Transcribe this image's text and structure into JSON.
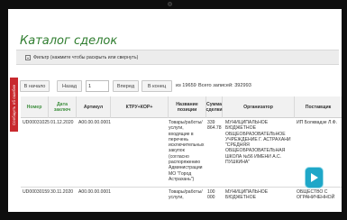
{
  "page": {
    "title": "Каталог сделок",
    "filter_label": "Фильтр (нажмите чтобы раскрыть или свернуть)",
    "side_tab_label": "Сообщить об ошибке"
  },
  "pager": {
    "first_label": "В начало",
    "prev_label": "Назад",
    "current_page": "1",
    "next_label": "Вперед",
    "last_label": "В конец",
    "of_text": "из 19659",
    "total_text": "Всего записей: 392993"
  },
  "table": {
    "headers": {
      "number": "Номер",
      "date": "Дата заключ",
      "article": "Артикул",
      "ktru": "КТРУ+КОР+",
      "name": "Название позиции",
      "sum": "Сумма сделки",
      "organizer": "Организатор",
      "supplier": "Поставщик"
    },
    "rows": [
      {
        "number": "UD00031025",
        "date": "01.12.2020",
        "article": "A00.00.00.0001",
        "ktru": "",
        "name": "Товары/работы/ услуги, входящие в перечень исключительных закупок (согласно распоряжению Администрации МО \"Город Астрахань\")",
        "sum": "339 864.78",
        "organizer": "МУНИЦИПАЛЬНОЕ БЮДЖЕТНОЕ ОБЩЕОБРАЗОВАТЕЛЬНОЕ УЧРЕЖДЕНИЕ Г. АСТРАХАНИ \"СРЕДНЯЯ ОБЩЕОБРАЗОВАТЕЛЬНАЯ ШКОЛА №56 ИМЕНИ А.С. ПУШКИНА\"",
        "supplier": "ИП Болквадзе Л.Ф."
      },
      {
        "number": "UD00030159",
        "date": "30.11.2020",
        "article": "A00.00.00.0001",
        "ktru": "",
        "name": "Товары/работы/ услуги,",
        "sum": "100 000",
        "organizer": "МУНИЦИПАЛЬНОЕ БЮДЖЕТНОЕ",
        "supplier": "ОБЩЕСТВО С ОГРАНИЧЕННОЙ"
      }
    ]
  },
  "colors": {
    "title_green": "#2f7d2f",
    "header_green": "#3f8f3f",
    "side_tab_red": "#c8292e",
    "play_button": "#1fa7c8"
  },
  "icons": {
    "filter": "filter-icon",
    "play": "play-icon"
  }
}
